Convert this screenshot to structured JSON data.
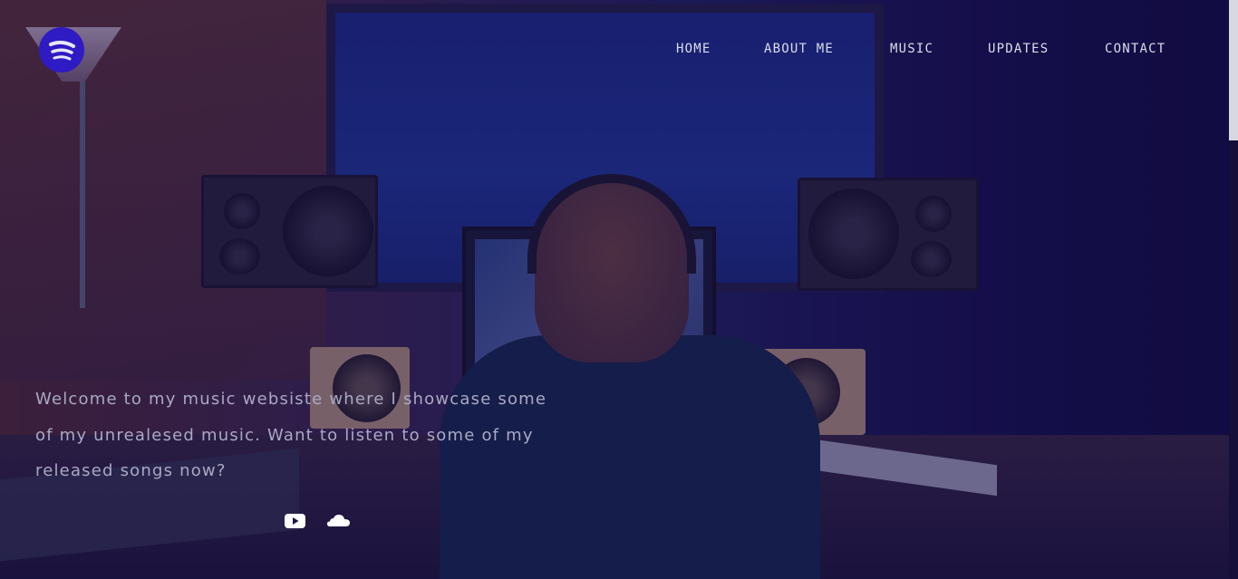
{
  "brand": {
    "logo_icon": "spotify-icon",
    "logo_color": "#2e1bc4"
  },
  "nav": {
    "items": [
      {
        "label": "HOME"
      },
      {
        "label": "ABOUT ME"
      },
      {
        "label": "MUSIC"
      },
      {
        "label": "UPDATES"
      },
      {
        "label": "CONTACT"
      }
    ]
  },
  "hero": {
    "line1": "Welcome to my music websiste where I showcase some",
    "line2": "of my unrealesed music. Want to listen to some of my",
    "line3": "released songs now?"
  },
  "social": {
    "youtube_icon": "youtube-icon",
    "soundcloud_icon": "soundcloud-icon"
  },
  "colors": {
    "overlay": "#160f50",
    "text": "#a9a9c4",
    "nav_text": "#dcdcea"
  }
}
